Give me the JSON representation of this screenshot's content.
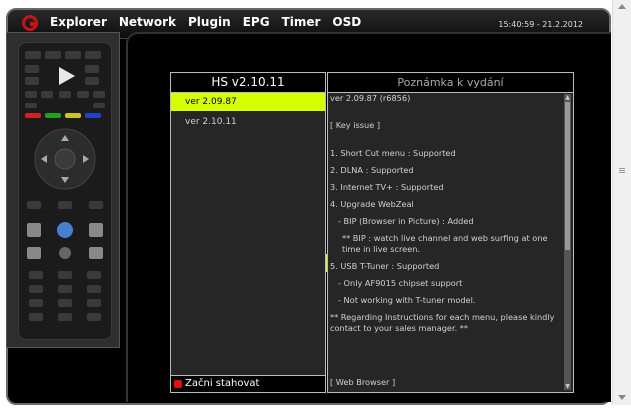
{
  "menu": [
    "Explorer",
    "Network",
    "Plugin",
    "EPG",
    "Timer",
    "OSD"
  ],
  "clock": "15:40:59 - 21.2.2012",
  "left_panel": {
    "title": "HS v2.10.11",
    "versions": [
      "ver 2.09.87",
      "ver 2.10.11"
    ],
    "selected_index": 0,
    "footer_label": "Začni stahovat"
  },
  "right_panel": {
    "title": "Poznámka k vydání",
    "lines": [
      "ver 2.09.87 (r6856)",
      "",
      "[ Key issue ]",
      "",
      "1. Short Cut menu : Supported",
      "2. DLNA : Supported",
      "3. Internet TV+ : Supported",
      "4. Upgrade WebZeal",
      "   - BIP (Browser in Picture) : Added",
      "     ** BIP : watch live channel and web surfing at one time in live screen.",
      "5. USB T-Tuner : Supported",
      "   - Only AF9015 chipset support",
      "   - Not working with T-tuner model.",
      "** Regarding Instructions for each menu, please kindly contact to your sales manager. **"
    ],
    "last_line": "[ Web Browser ]"
  },
  "colors": {
    "selected_bg": "#d6ff00",
    "footer_button": "#e01010",
    "logo": "#cc1111"
  }
}
